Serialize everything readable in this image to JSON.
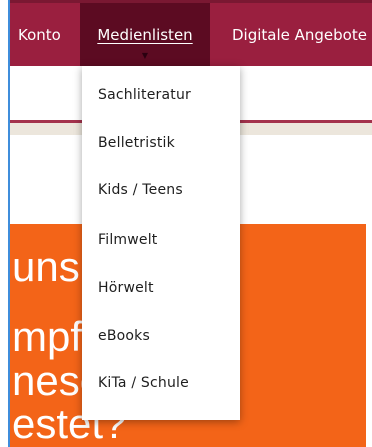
{
  "nav": {
    "items": [
      {
        "label": "Konto"
      },
      {
        "label": "Medienlisten"
      },
      {
        "label": "Digitale Angebote"
      }
    ],
    "caret_icon": "caret-down-icon"
  },
  "dropdown": {
    "items": [
      {
        "label": "Sachliteratur"
      },
      {
        "label": "Belletristik"
      },
      {
        "label": "Kids / Teens"
      },
      {
        "label": "Filmwelt"
      },
      {
        "label": "Hörwelt"
      },
      {
        "label": "eBooks"
      },
      {
        "label": "KiTa / Schule"
      }
    ]
  },
  "hero": {
    "lines": [
      "uns",
      "mpf",
      "nese",
      "estet?"
    ]
  },
  "colors": {
    "nav_bg": "#9a1f3f",
    "nav_active_bg": "#5c0b22",
    "hero_bg": "#f36418",
    "beige": "#ece6dc"
  }
}
